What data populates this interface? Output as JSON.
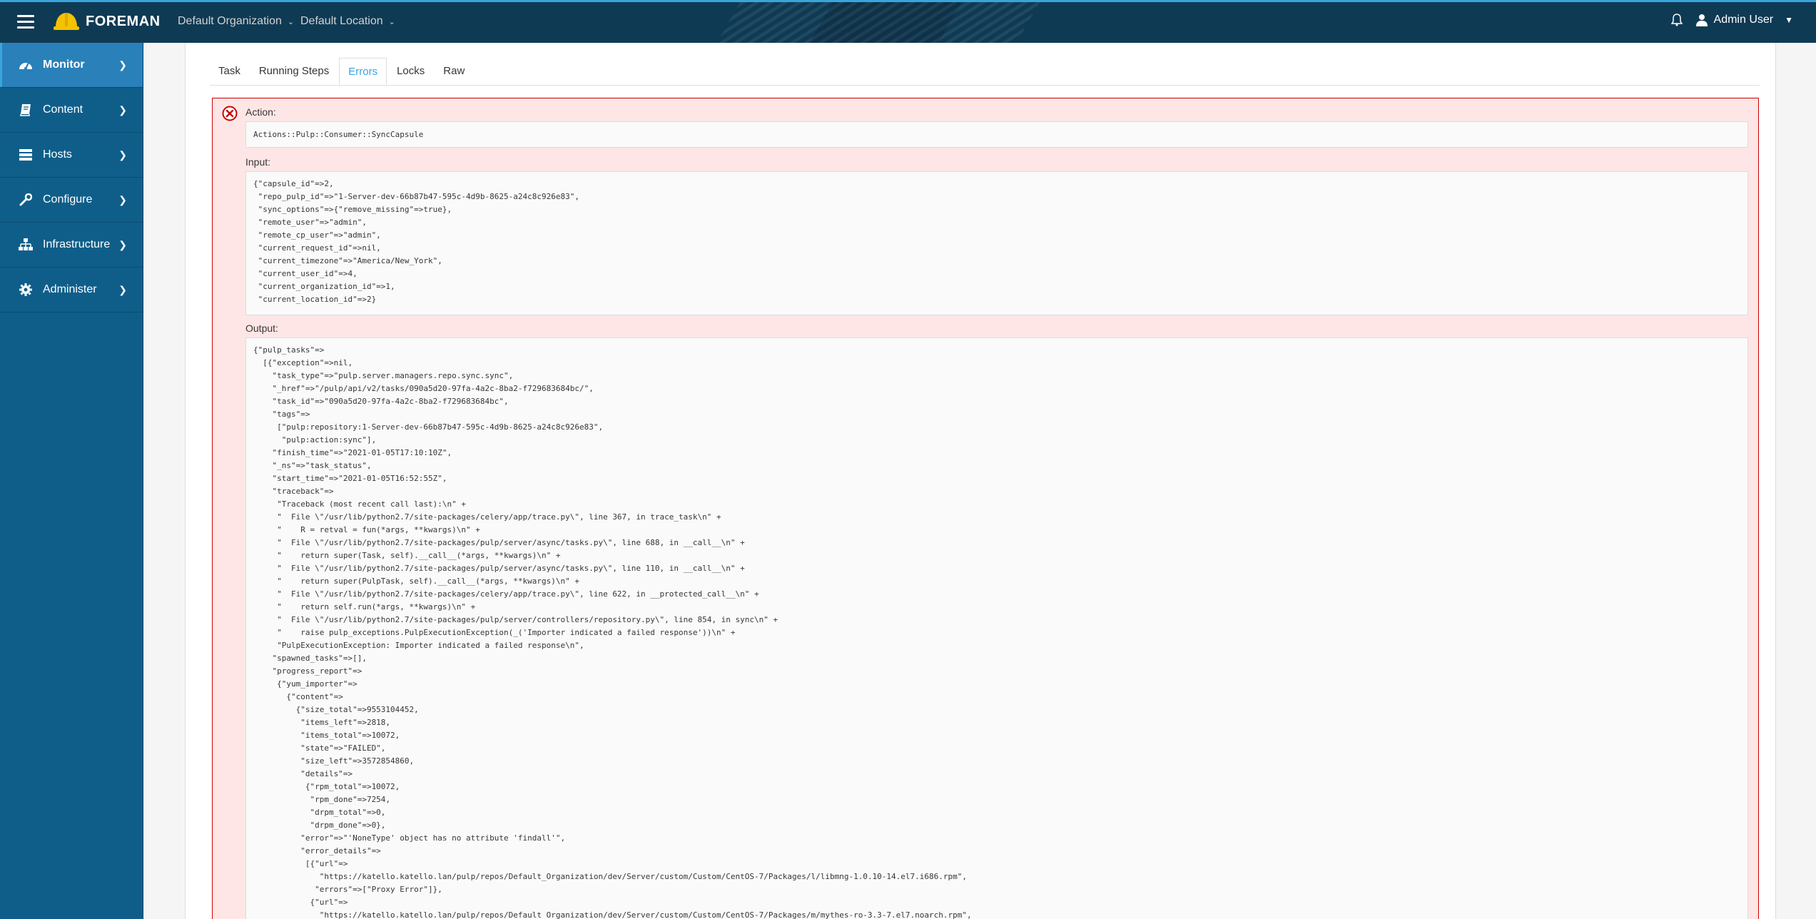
{
  "header": {
    "brand": "FOREMAN",
    "organization": "Default Organization",
    "location": "Default Location",
    "user": "Admin User"
  },
  "sidebar": {
    "items": [
      {
        "label": "Monitor",
        "icon": "tachometer-icon",
        "active": true
      },
      {
        "label": "Content",
        "icon": "book-icon"
      },
      {
        "label": "Hosts",
        "icon": "server-icon"
      },
      {
        "label": "Configure",
        "icon": "wrench-icon"
      },
      {
        "label": "Infrastructure",
        "icon": "sitemap-icon"
      },
      {
        "label": "Administer",
        "icon": "gear-icon"
      }
    ]
  },
  "tabs": [
    "Task",
    "Running Steps",
    "Errors",
    "Locks",
    "Raw"
  ],
  "active_tab": "Errors",
  "error": {
    "action_label": "Action:",
    "action_value": "Actions::Pulp::Consumer::SyncCapsule",
    "input_label": "Input:",
    "input_value": "{\"capsule_id\"=>2,\n \"repo_pulp_id\"=>\"1-Server-dev-66b87b47-595c-4d9b-8625-a24c8c926e83\",\n \"sync_options\"=>{\"remove_missing\"=>true},\n \"remote_user\"=>\"admin\",\n \"remote_cp_user\"=>\"admin\",\n \"current_request_id\"=>nil,\n \"current_timezone\"=>\"America/New_York\",\n \"current_user_id\"=>4,\n \"current_organization_id\"=>1,\n \"current_location_id\"=>2}",
    "output_label": "Output:",
    "output_value": "{\"pulp_tasks\"=>\n  [{\"exception\"=>nil,\n    \"task_type\"=>\"pulp.server.managers.repo.sync.sync\",\n    \"_href\"=>\"/pulp/api/v2/tasks/090a5d20-97fa-4a2c-8ba2-f729683684bc/\",\n    \"task_id\"=>\"090a5d20-97fa-4a2c-8ba2-f729683684bc\",\n    \"tags\"=>\n     [\"pulp:repository:1-Server-dev-66b87b47-595c-4d9b-8625-a24c8c926e83\",\n      \"pulp:action:sync\"],\n    \"finish_time\"=>\"2021-01-05T17:10:10Z\",\n    \"_ns\"=>\"task_status\",\n    \"start_time\"=>\"2021-01-05T16:52:55Z\",\n    \"traceback\"=>\n     \"Traceback (most recent call last):\\n\" +\n     \"  File \\\"/usr/lib/python2.7/site-packages/celery/app/trace.py\\\", line 367, in trace_task\\n\" +\n     \"    R = retval = fun(*args, **kwargs)\\n\" +\n     \"  File \\\"/usr/lib/python2.7/site-packages/pulp/server/async/tasks.py\\\", line 688, in __call__\\n\" +\n     \"    return super(Task, self).__call__(*args, **kwargs)\\n\" +\n     \"  File \\\"/usr/lib/python2.7/site-packages/pulp/server/async/tasks.py\\\", line 110, in __call__\\n\" +\n     \"    return super(PulpTask, self).__call__(*args, **kwargs)\\n\" +\n     \"  File \\\"/usr/lib/python2.7/site-packages/celery/app/trace.py\\\", line 622, in __protected_call__\\n\" +\n     \"    return self.run(*args, **kwargs)\\n\" +\n     \"  File \\\"/usr/lib/python2.7/site-packages/pulp/server/controllers/repository.py\\\", line 854, in sync\\n\" +\n     \"    raise pulp_exceptions.PulpExecutionException(_('Importer indicated a failed response'))\\n\" +\n     \"PulpExecutionException: Importer indicated a failed response\\n\",\n    \"spawned_tasks\"=>[],\n    \"progress_report\"=>\n     {\"yum_importer\"=>\n       {\"content\"=>\n         {\"size_total\"=>9553104452,\n          \"items_left\"=>2818,\n          \"items_total\"=>10072,\n          \"state\"=>\"FAILED\",\n          \"size_left\"=>3572854860,\n          \"details\"=>\n           {\"rpm_total\"=>10072,\n            \"rpm_done\"=>7254,\n            \"drpm_total\"=>0,\n            \"drpm_done\"=>0},\n          \"error\"=>\"'NoneType' object has no attribute 'findall'\",\n          \"error_details\"=>\n           [{\"url\"=>\n              \"https://katello.katello.lan/pulp/repos/Default_Organization/dev/Server/custom/Custom/CentOS-7/Packages/l/libmng-1.0.10-14.el7.i686.rpm\",\n             \"errors\"=>[\"Proxy Error\"]},\n            {\"url\"=>\n              \"https://katello.katello.lan/pulp/repos/Default_Organization/dev/Server/custom/Custom/CentOS-7/Packages/m/mythes-ro-3.3-7.el7.noarch.rpm\","
  }
}
